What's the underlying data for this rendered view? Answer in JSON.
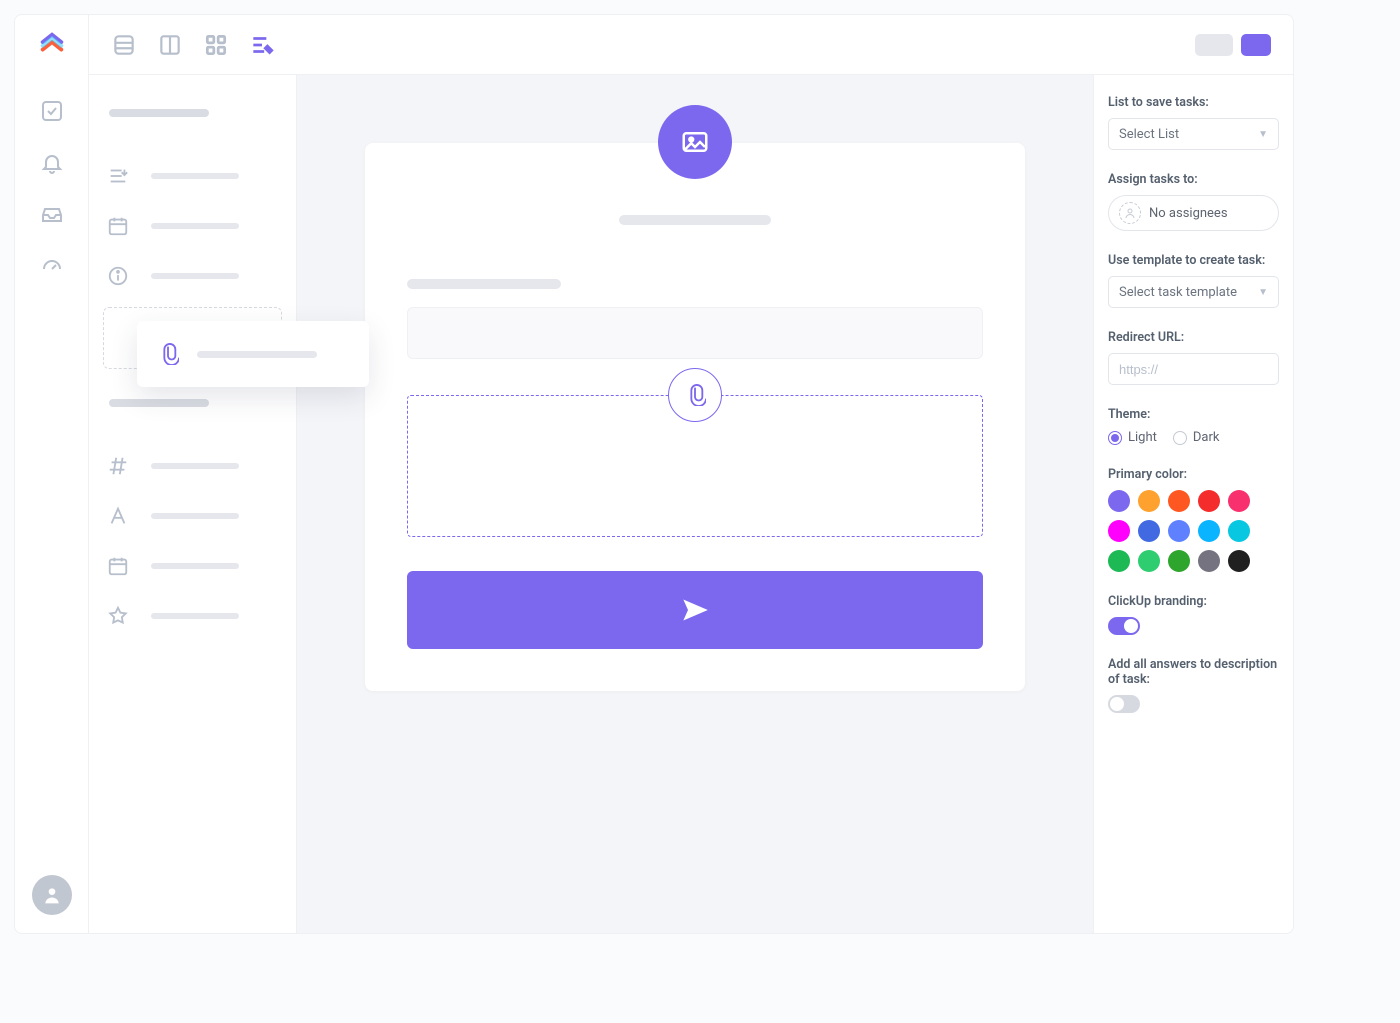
{
  "settings": {
    "list_label": "List to save tasks:",
    "list_value": "Select List",
    "assign_label": "Assign tasks to:",
    "assign_value": "No assignees",
    "template_label": "Use template to create task:",
    "template_value": "Select task template",
    "redirect_label": "Redirect URL:",
    "redirect_placeholder": "https://",
    "theme_label": "Theme:",
    "theme_light": "Light",
    "theme_dark": "Dark",
    "theme_selected": "light",
    "primary_label": "Primary color:",
    "primary_colors": [
      "#7b68ee",
      "#ffa12f",
      "#ff5722",
      "#f42c2c",
      "#f8306d",
      "#ff00fc",
      "#4169e1",
      "#5f81ff",
      "#0ab4ff",
      "#08c7e0",
      "#1db954",
      "#2ecd6f",
      "#2ea52c",
      "#757380",
      "#202020"
    ],
    "branding_label": "ClickUp branding:",
    "branding_on": true,
    "answers_label": "Add all answers to description of task:",
    "answers_on": false
  }
}
